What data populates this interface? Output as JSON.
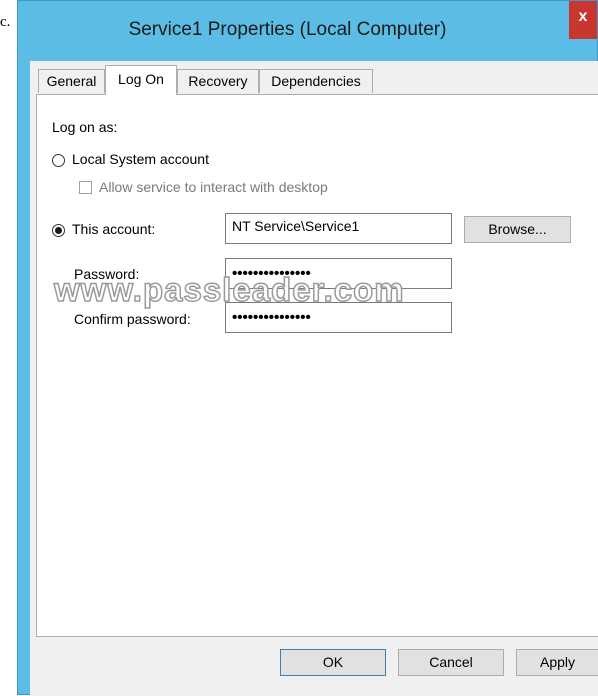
{
  "fragment_text": "c.",
  "window": {
    "title": "Service1 Properties (Local Computer)",
    "close_label": "x"
  },
  "tabs": [
    {
      "label": "General",
      "active": false
    },
    {
      "label": "Log On",
      "active": true
    },
    {
      "label": "Recovery",
      "active": false
    },
    {
      "label": "Dependencies",
      "active": false
    }
  ],
  "logon": {
    "section_label": "Log on as:",
    "local_system_label": "Local System account",
    "local_system_selected": false,
    "interact_label": "Allow service to interact with desktop",
    "interact_checked": false,
    "this_account_label": "This account:",
    "this_account_selected": true,
    "account_value": "NT Service\\Service1",
    "browse_label": "Browse...",
    "password_label": "Password:",
    "password_value": "•••••••••••••••",
    "confirm_label": "Confirm password:",
    "confirm_value": "•••••••••••••••"
  },
  "watermark": "www.passleader.com",
  "buttons": {
    "ok": "OK",
    "cancel": "Cancel",
    "apply": "Apply"
  }
}
